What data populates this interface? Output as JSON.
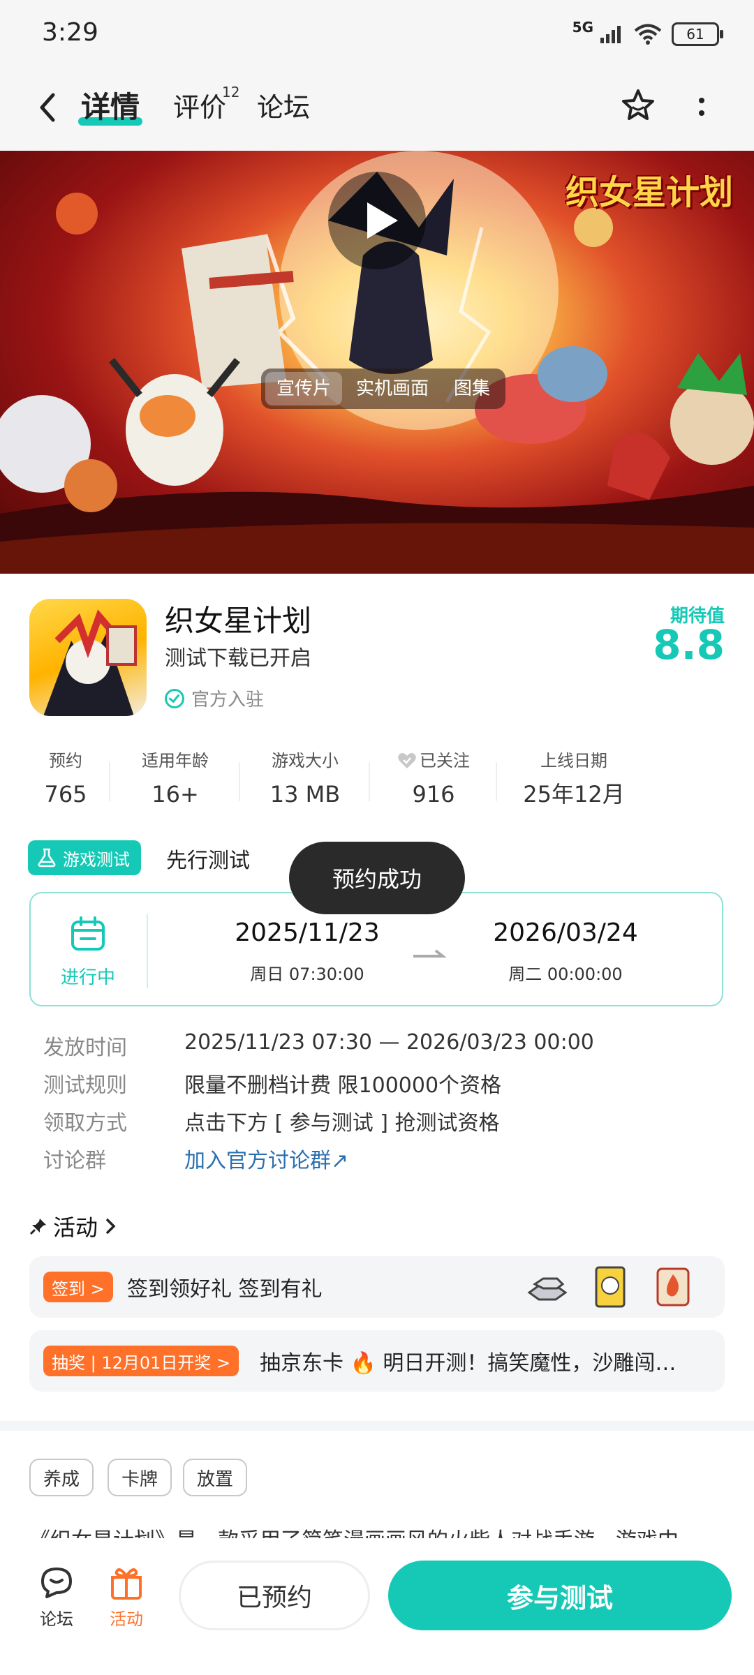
{
  "status_bar": {
    "time": "3:29",
    "network": "5G",
    "battery": "61"
  },
  "nav": {
    "tabs": [
      {
        "label": "详情"
      },
      {
        "label": "评价",
        "badge": "12"
      },
      {
        "label": "论坛"
      }
    ]
  },
  "banner": {
    "logo_text": "织女星计划",
    "media_tabs": [
      "宣传片",
      "实机画面",
      "图集"
    ]
  },
  "game": {
    "title": "织女星计划",
    "subtitle": "测试下载已开启",
    "official": "官方入驻",
    "expect_label": "期待值",
    "expect_value": "8.8"
  },
  "stats": [
    {
      "label": "预约",
      "value": "765"
    },
    {
      "label": "适用年龄",
      "value": "16+"
    },
    {
      "label": "游戏大小",
      "value": "13 MB"
    },
    {
      "label": "已关注",
      "value": "916"
    },
    {
      "label": "上线日期",
      "value": "25年12月"
    }
  ],
  "test": {
    "badge": "游戏测试",
    "label": "先行测试",
    "status": "进行中",
    "start_date": "2025/11/23",
    "start_time": "周日  07:30:00",
    "end_date": "2026/03/24",
    "end_time": "周二  00:00:00",
    "toast": "预约成功"
  },
  "details": [
    {
      "label": "发放时间",
      "value": "2025/11/23 07:30 — 2026/03/23 00:00"
    },
    {
      "label": "测试规则",
      "value": "限量不删档计费 限100000个资格"
    },
    {
      "label": "领取方式",
      "value": "点击下方 [ 参与测试 ] 抢测试资格"
    },
    {
      "label": "讨论群",
      "value": "加入官方讨论群↗"
    }
  ],
  "activities": {
    "title": "活动",
    "items": [
      {
        "tag": "签到 >",
        "text": "签到领好礼 签到有礼"
      },
      {
        "tag": "抽奖 | 12月01日开奖 >",
        "text": "抽京东卡 🔥 明日开测！搞笑魔性，沙雕闯…"
      }
    ]
  },
  "tags": [
    "养成",
    "卡牌",
    "放置"
  ],
  "description": "《织女星计划》是一款采用了简笔漫画画风的火柴人对战手游。游戏中",
  "bottom": {
    "forum_label": "论坛",
    "activity_label": "活动",
    "reserved_label": "已预约",
    "join_label": "参与测试"
  },
  "colors": {
    "accent": "#16c9b6",
    "orange": "#ff7028",
    "link": "#2a6fb0"
  }
}
